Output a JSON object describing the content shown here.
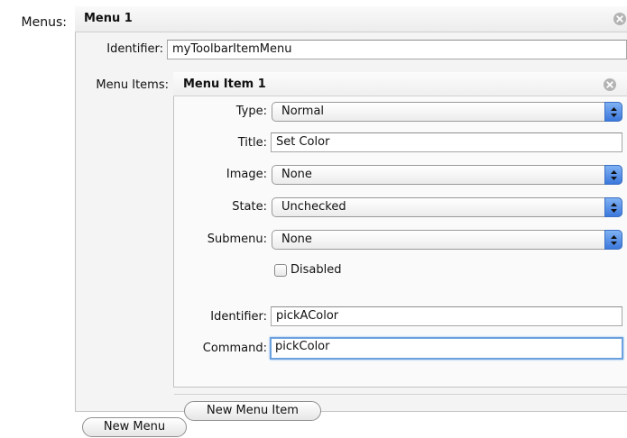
{
  "menus_label": "Menus:",
  "menu": {
    "title": "Menu 1",
    "identifier_label": "Identifier:",
    "identifier_value": "myToolbarItemMenu",
    "menu_items_label": "Menu Items:"
  },
  "menu_item": {
    "title": "Menu Item 1",
    "type_label": "Type:",
    "type_value": "Normal",
    "title_label": "Title:",
    "title_value": "Set Color",
    "image_label": "Image:",
    "image_value": "None",
    "state_label": "State:",
    "state_value": "Unchecked",
    "submenu_label": "Submenu:",
    "submenu_value": "None",
    "disabled_label": "Disabled",
    "identifier_label": "Identifier:",
    "identifier_value": "pickAColor",
    "command_label": "Command:",
    "command_value": "pickColor"
  },
  "buttons": {
    "new_menu_item": "New Menu Item",
    "new_menu": "New Menu"
  },
  "icons": {
    "close": "close-circle-icon",
    "popup_arrows": "updown-arrows-icon"
  },
  "colors": {
    "focus_ring": "#6ba1de",
    "popup_accent": "#3b78dc"
  }
}
